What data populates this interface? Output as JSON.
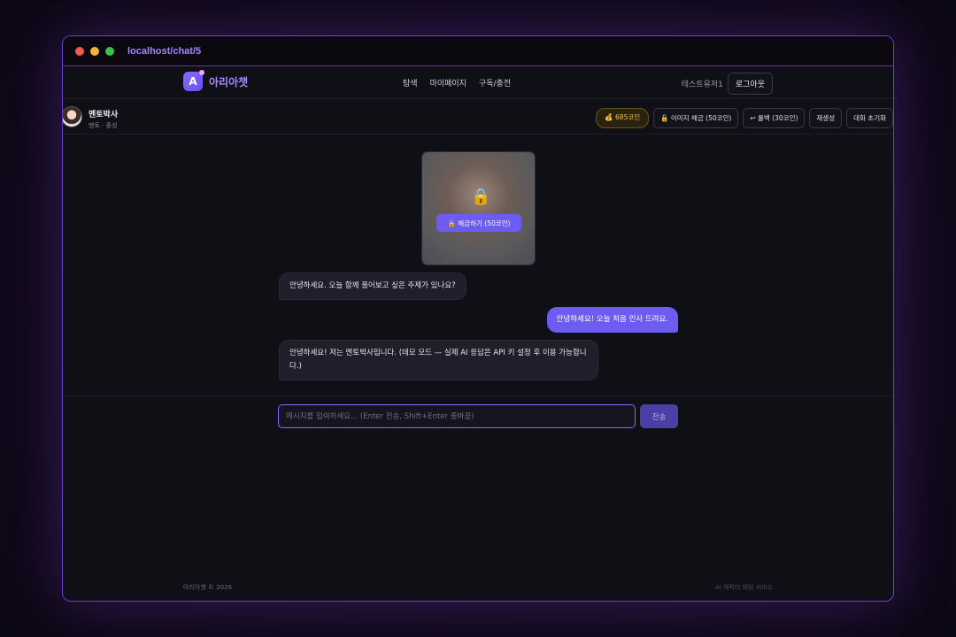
{
  "browser": {
    "url": "localhost/chat/5"
  },
  "nav": {
    "brand_icon": "A",
    "brand_name": "아리아챗",
    "menu": [
      "탐색",
      "마이페이지",
      "구독/충전"
    ],
    "username": "테스트유저1",
    "logout_label": "로그아웃"
  },
  "chat_header": {
    "name": "멘토박사",
    "meta": "멘토 · 중성",
    "coins": "💰 685코인",
    "actions": [
      "🔓 이미지 해금 (50코인)",
      "↩ 롤백 (30코인)",
      "재생성",
      "대화 초기화"
    ]
  },
  "locked_image": {
    "lock_icon": "🔒",
    "unlock_label": "🔓 해금하기 (50코인)"
  },
  "messages": [
    {
      "role": "bot",
      "text": "안녕하세요. 오늘 함께 풀어보고 싶은 주제가 있나요?"
    },
    {
      "role": "user",
      "text": "안녕하세요! 오늘 처음 인사 드려요."
    },
    {
      "role": "bot",
      "text": "안녕하세요! 저는 멘토박사입니다. (데모 모드 — 실제 AI 응답은 API 키 설정 후 이용 가능합니다.)"
    }
  ],
  "composer": {
    "placeholder": "메시지를 입력하세요... (Enter 전송, Shift+Enter 줄바꿈)",
    "send_label": "전송"
  },
  "footer": {
    "left": "아리아챗 © 2026",
    "right": "AI 캐릭터 채팅 서비스"
  },
  "colors": {
    "accent": "#6c5cf2",
    "brand": "#a58bff",
    "coin": "#f3c34a",
    "window_border": "#6b3fc9"
  }
}
